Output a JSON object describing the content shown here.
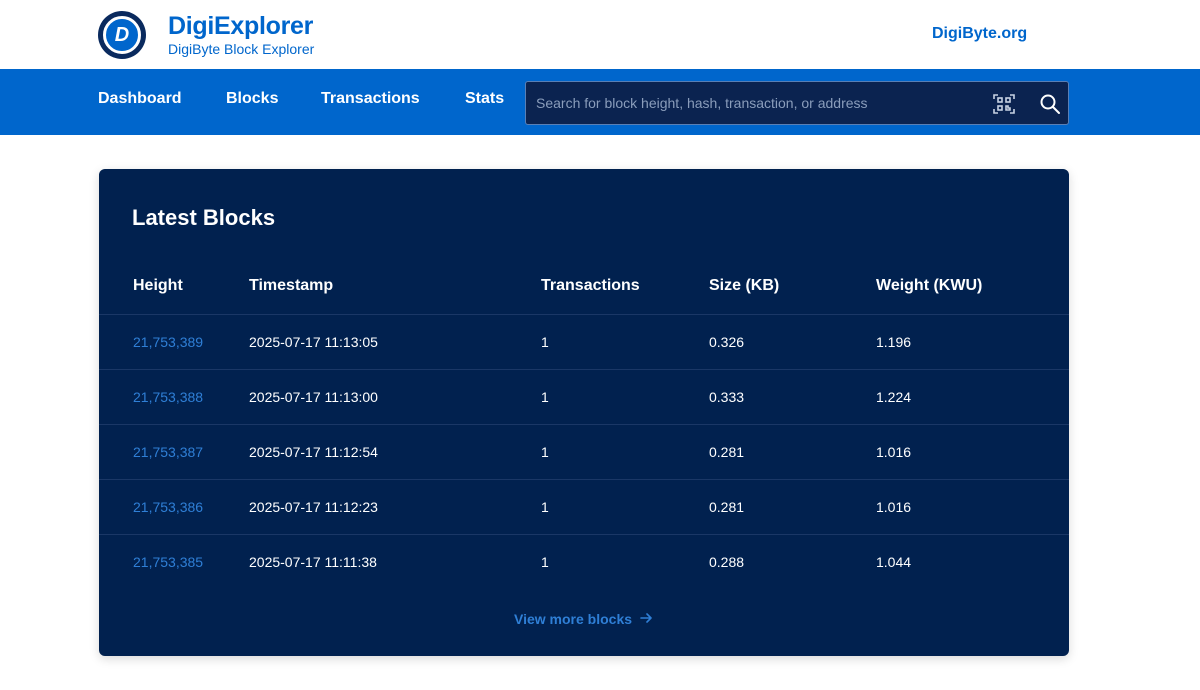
{
  "brand": {
    "logo_letter": "D",
    "title": "DigiExplorer",
    "subtitle": "DigiByte Block Explorer",
    "site_link": "DigiByte.org"
  },
  "nav": {
    "items": [
      {
        "label": "Dashboard"
      },
      {
        "label": "Blocks"
      },
      {
        "label": "Transactions"
      },
      {
        "label": "Stats"
      }
    ]
  },
  "search": {
    "placeholder": "Search for block height, hash, transaction, or address",
    "qr_icon": "qr-code-icon",
    "search_icon": "search-icon"
  },
  "latest_blocks": {
    "title": "Latest Blocks",
    "columns": [
      "Height",
      "Timestamp",
      "Transactions",
      "Size (KB)",
      "Weight (KWU)"
    ],
    "rows": [
      {
        "height": "21,753,389",
        "timestamp": "2025-07-17 11:13:05",
        "transactions": "1",
        "size": "0.326",
        "weight": "1.196"
      },
      {
        "height": "21,753,388",
        "timestamp": "2025-07-17 11:13:00",
        "transactions": "1",
        "size": "0.333",
        "weight": "1.224"
      },
      {
        "height": "21,753,387",
        "timestamp": "2025-07-17 11:12:54",
        "transactions": "1",
        "size": "0.281",
        "weight": "1.016"
      },
      {
        "height": "21,753,386",
        "timestamp": "2025-07-17 11:12:23",
        "transactions": "1",
        "size": "0.281",
        "weight": "1.016"
      },
      {
        "height": "21,753,385",
        "timestamp": "2025-07-17 11:11:38",
        "transactions": "1",
        "size": "0.288",
        "weight": "1.044"
      }
    ],
    "view_more": "View more blocks"
  },
  "colors": {
    "brand_blue": "#0066cc",
    "card_navy": "#01214f",
    "link_blue": "#2f7fd6"
  }
}
